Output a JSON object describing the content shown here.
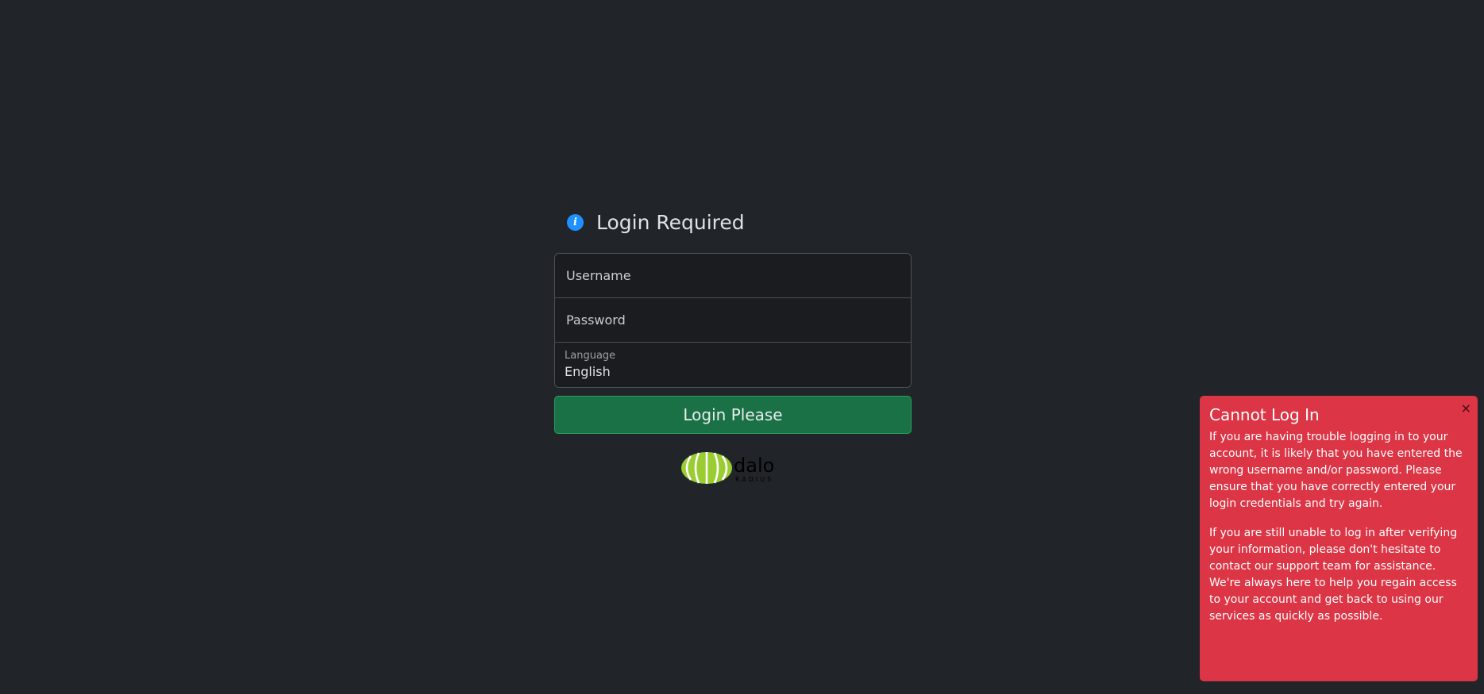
{
  "heading": {
    "icon": "info-icon",
    "icon_glyph": "i",
    "title": "Login Required"
  },
  "form": {
    "username_placeholder": "Username",
    "password_placeholder": "Password",
    "language_label": "Language",
    "language_value": "English",
    "submit_label": "Login Please"
  },
  "logo": {
    "name": "daloradius-logo",
    "brand_colors": [
      "#9acd32",
      "#000000"
    ]
  },
  "alert": {
    "title": "Cannot Log In",
    "close_glyph": "×",
    "paragraph_1": "If you are having trouble logging in to your account, it is likely that you have entered the wrong username and/or password. Please ensure that you have correctly entered your login credentials and try again.",
    "paragraph_2": "If you are still unable to log in after verifying your information, please don't hesitate to contact our support team for assistance. We're always here to help you regain access to your account and get back to using our services as quickly as possible."
  },
  "colors": {
    "background": "#212529",
    "accent": "#1e90ff",
    "submit": "#197145",
    "alert": "#dc3545"
  }
}
